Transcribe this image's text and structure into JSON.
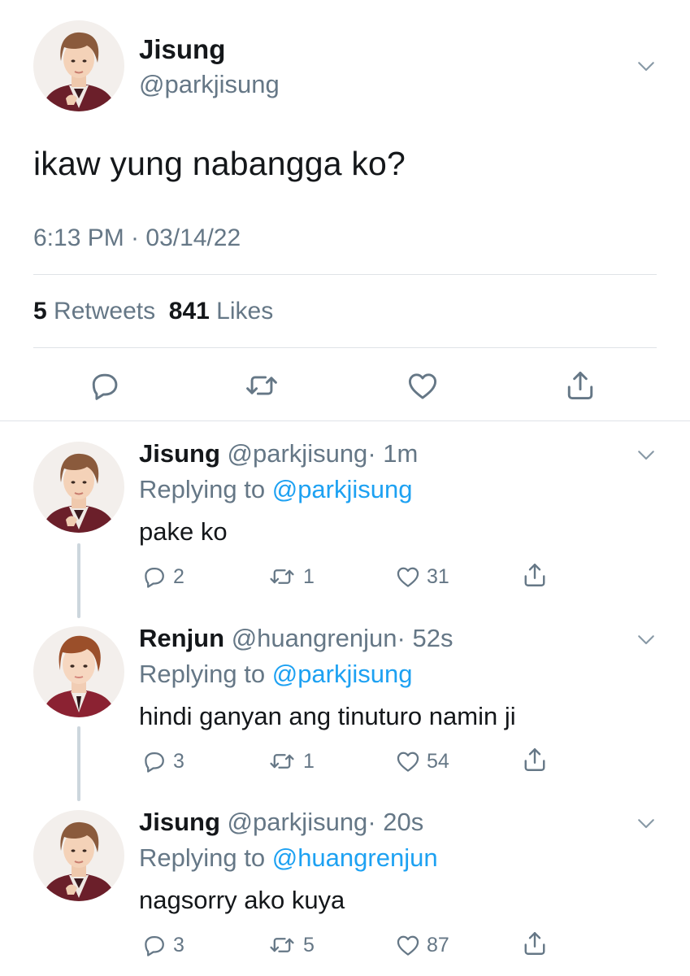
{
  "main_tweet": {
    "author": {
      "name": "Jisung",
      "handle": "@parkjisung",
      "avatar_icon": "avatar-jisung"
    },
    "text": "ikaw yung nabangga ko?",
    "timestamp": "6:13 PM · 03/14/22",
    "stats": {
      "retweets": "5",
      "retweets_label": "Retweets",
      "likes": "841",
      "likes_label": "Likes"
    },
    "actions": [
      "reply-icon",
      "retweet-icon",
      "like-icon",
      "share-icon"
    ]
  },
  "replies": [
    {
      "name": "Jisung",
      "handle": "@parkjisung",
      "time": "· 1m",
      "replying_prefix": "Replying to",
      "replying_to": "@parkjisung",
      "text": "pake ko",
      "replies": "2",
      "retweets": "1",
      "likes": "31"
    },
    {
      "name": "Renjun",
      "handle": "@huangrenjun",
      "time": "· 52s",
      "replying_prefix": "Replying to",
      "replying_to": "@parkjisung",
      "text": "hindi ganyan ang tinuturo namin ji",
      "replies": "3",
      "retweets": "1",
      "likes": "54"
    },
    {
      "name": "Jisung",
      "handle": "@parkjisung",
      "time": "· 20s",
      "replying_prefix": "Replying to",
      "replying_to": "@huangrenjun",
      "text": "nagsorry ako kuya",
      "replies": "3",
      "retweets": "5",
      "likes": "87"
    }
  ],
  "colors": {
    "text": "#14171a",
    "muted": "#657786",
    "link": "#1da1f2",
    "divider": "#dfe3e7",
    "thread_line": "#ccd6dd"
  }
}
